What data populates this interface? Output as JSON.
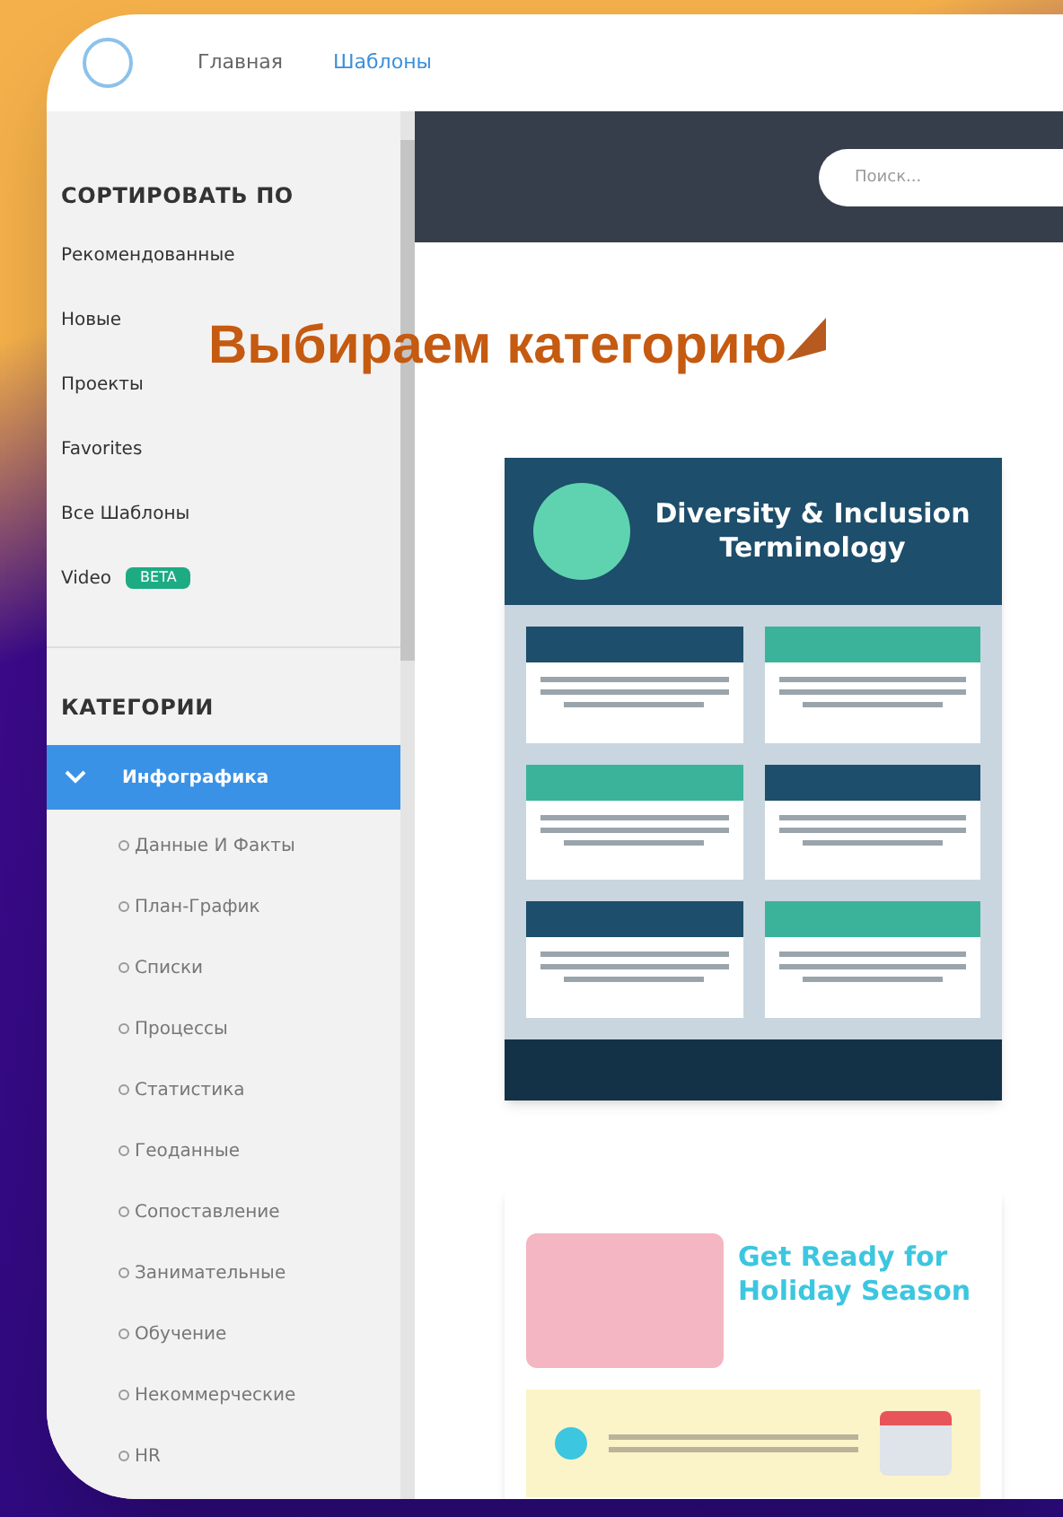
{
  "nav": [
    {
      "label": "Главная",
      "selected": false
    },
    {
      "label": "Шаблоны",
      "selected": true
    }
  ],
  "search": {
    "placeholder": "Поиск..."
  },
  "sort": {
    "title": "СОРТИРОВАТЬ ПО",
    "items": [
      {
        "label": "Рекомендованные"
      },
      {
        "label": "Новые"
      },
      {
        "label": "Проекты"
      },
      {
        "label": "Favorites"
      },
      {
        "label": "Все Шаблоны"
      },
      {
        "label": "Video",
        "badge": "BETA"
      }
    ]
  },
  "categories": {
    "title": "КАТЕГОРИИ",
    "items": [
      {
        "label": "Инфографика",
        "selected": true,
        "expanded": true,
        "children": [
          {
            "label": "Данные И Факты"
          },
          {
            "label": "План-График"
          },
          {
            "label": "Списки"
          },
          {
            "label": "Процессы"
          },
          {
            "label": "Статистика"
          },
          {
            "label": "Геоданные"
          },
          {
            "label": "Сопоставление"
          },
          {
            "label": "Занимательные"
          },
          {
            "label": "Обучение"
          },
          {
            "label": "Некоммерческие"
          },
          {
            "label": "HR"
          }
        ]
      }
    ]
  },
  "callout": "Выбираем категорию",
  "templates": [
    {
      "kind": "terms",
      "title": "Diversity & Inclusion Terminology"
    },
    {
      "kind": "holiday",
      "title": "Get Ready for Holiday Season"
    }
  ]
}
